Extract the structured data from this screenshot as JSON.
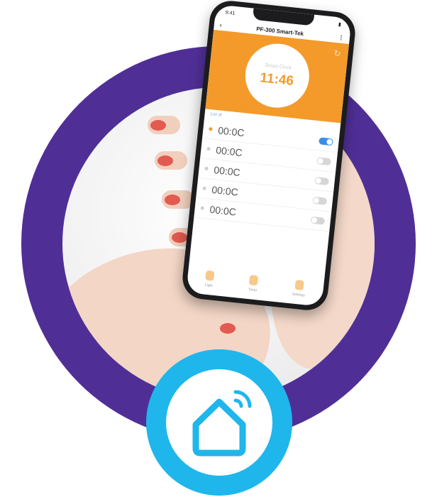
{
  "app": {
    "title": "PF-300 Smart-Tek",
    "status_time": "9:41",
    "nav_back": "‹",
    "nav_menu": "⋮"
  },
  "clock": {
    "label": "Smart Clock",
    "time": "11:46"
  },
  "list_label": "List of",
  "timers": [
    {
      "time": "00:0C",
      "enabled": true
    },
    {
      "time": "00:0C",
      "enabled": false
    },
    {
      "time": "00:0C",
      "enabled": false
    },
    {
      "time": "00:0C",
      "enabled": false
    },
    {
      "time": "00:0C",
      "enabled": false
    }
  ],
  "tabs": [
    {
      "label": "Light"
    },
    {
      "label": "Timer"
    },
    {
      "label": "Settings"
    }
  ],
  "colors": {
    "ring": "#4f2f96",
    "header": "#f39a2b",
    "badge": "#1fb6ec",
    "toggle_on": "#3b8ee8"
  },
  "icons": [
    "refresh-icon",
    "smart-home-icon",
    "wifi-signal-icon"
  ]
}
